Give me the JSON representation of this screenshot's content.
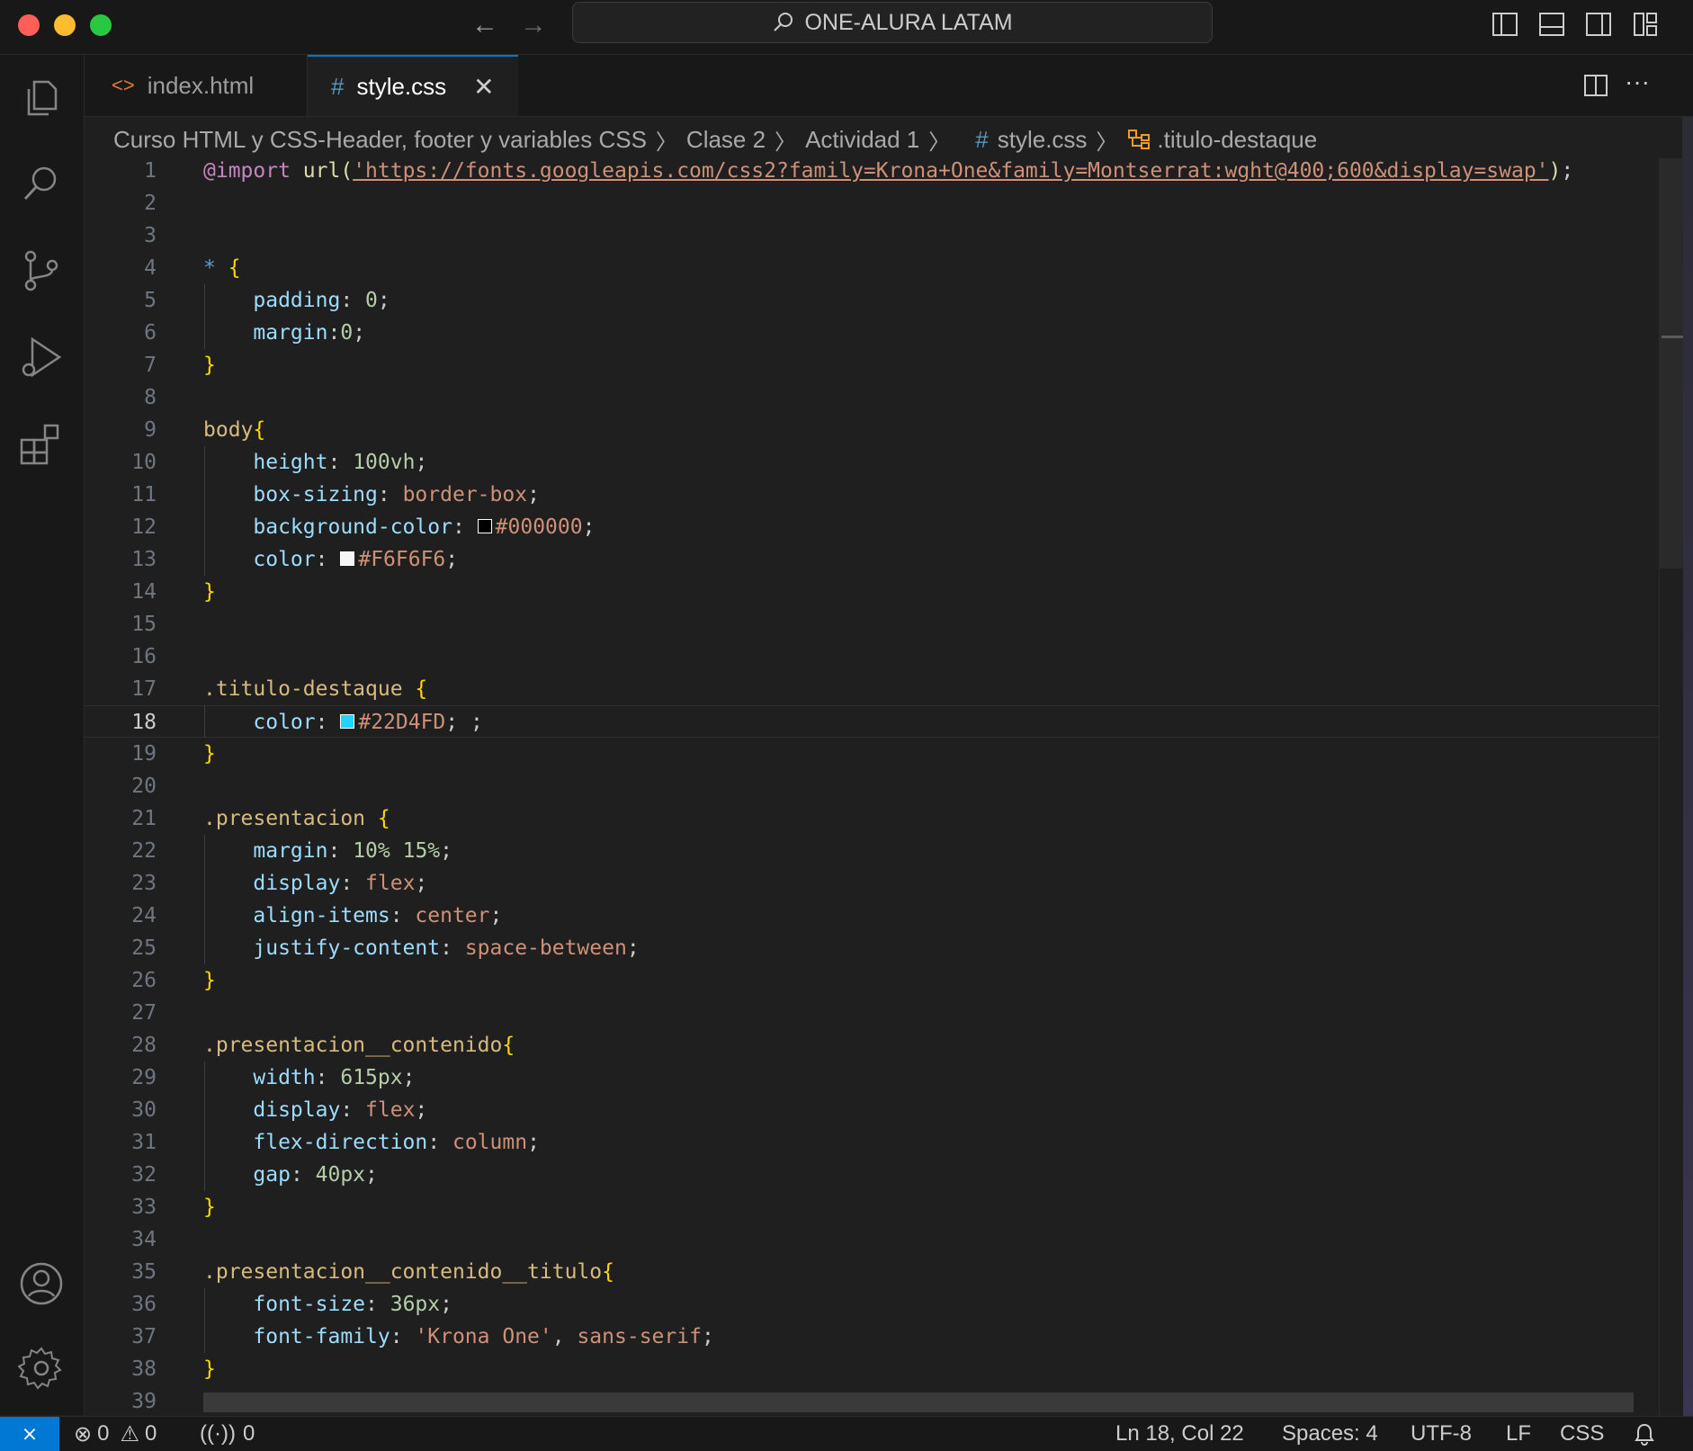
{
  "window": {
    "search_title": "ONE-ALURA LATAM",
    "traffic_lights": [
      "#ff5f57",
      "#febc2e",
      "#28c840"
    ]
  },
  "tabs": [
    {
      "label": "index.html",
      "icon": "html-file-icon",
      "active": false
    },
    {
      "label": "style.css",
      "icon": "css-file-icon",
      "active": true
    }
  ],
  "breadcrumb": {
    "items": [
      "Curso HTML y CSS-Header, footer y variables CSS",
      "Clase 2",
      "Actividad 1",
      "style.css",
      ".titulo-destaque"
    ]
  },
  "editor": {
    "language": "CSS",
    "current_line": 18,
    "lines": [
      {
        "n": "1",
        "tokens": [
          [
            "at",
            "@import"
          ],
          [
            "plain",
            " "
          ],
          [
            "fn",
            "url("
          ],
          [
            "str-u",
            "'https://fonts.googleapis.com/css2?family=Krona+One&family=Montserrat:wght@400;600&display=swap'"
          ],
          [
            "fn",
            ")"
          ],
          [
            "plain",
            ";"
          ]
        ]
      },
      {
        "n": "2",
        "tokens": []
      },
      {
        "n": "3",
        "tokens": []
      },
      {
        "n": "4",
        "tokens": [
          [
            "star",
            "*"
          ],
          [
            "plain",
            " "
          ],
          [
            "brace",
            "{"
          ]
        ]
      },
      {
        "n": "5",
        "tokens": [
          [
            "plain",
            "    "
          ],
          [
            "prop",
            "padding"
          ],
          [
            "plain",
            ": "
          ],
          [
            "num",
            "0"
          ],
          [
            "plain",
            ";"
          ]
        ]
      },
      {
        "n": "6",
        "tokens": [
          [
            "plain",
            "    "
          ],
          [
            "prop",
            "margin"
          ],
          [
            "plain",
            ":"
          ],
          [
            "num",
            "0"
          ],
          [
            "plain",
            ";"
          ]
        ]
      },
      {
        "n": "7",
        "tokens": [
          [
            "brace",
            "}"
          ]
        ]
      },
      {
        "n": "8",
        "tokens": []
      },
      {
        "n": "9",
        "tokens": [
          [
            "sel",
            "body"
          ],
          [
            "brace",
            "{"
          ]
        ]
      },
      {
        "n": "10",
        "tokens": [
          [
            "plain",
            "    "
          ],
          [
            "prop",
            "height"
          ],
          [
            "plain",
            ": "
          ],
          [
            "num",
            "100vh"
          ],
          [
            "plain",
            ";"
          ]
        ]
      },
      {
        "n": "11",
        "tokens": [
          [
            "plain",
            "    "
          ],
          [
            "prop",
            "box-sizing"
          ],
          [
            "plain",
            ": "
          ],
          [
            "val",
            "border-box"
          ],
          [
            "plain",
            ";"
          ]
        ]
      },
      {
        "n": "12",
        "tokens": [
          [
            "plain",
            "    "
          ],
          [
            "prop",
            "background-color"
          ],
          [
            "plain",
            ": "
          ],
          [
            "swatch",
            "#000000"
          ],
          [
            "val",
            "#000000"
          ],
          [
            "plain",
            ";"
          ]
        ]
      },
      {
        "n": "13",
        "tokens": [
          [
            "plain",
            "    "
          ],
          [
            "prop",
            "color"
          ],
          [
            "plain",
            ": "
          ],
          [
            "swatch",
            "#F6F6F6"
          ],
          [
            "val",
            "#F6F6F6"
          ],
          [
            "plain",
            ";"
          ]
        ]
      },
      {
        "n": "14",
        "tokens": [
          [
            "brace",
            "}"
          ]
        ]
      },
      {
        "n": "15",
        "tokens": []
      },
      {
        "n": "16",
        "tokens": []
      },
      {
        "n": "17",
        "tokens": [
          [
            "sel",
            ".titulo-destaque"
          ],
          [
            "plain",
            " "
          ],
          [
            "brace",
            "{"
          ]
        ]
      },
      {
        "n": "18",
        "tokens": [
          [
            "plain",
            "    "
          ],
          [
            "prop",
            "color"
          ],
          [
            "plain",
            ": "
          ],
          [
            "swatch",
            "#22D4FD"
          ],
          [
            "val",
            "#22D4FD"
          ],
          [
            "plain",
            "; ;"
          ]
        ]
      },
      {
        "n": "19",
        "tokens": [
          [
            "brace",
            "}"
          ]
        ]
      },
      {
        "n": "20",
        "tokens": []
      },
      {
        "n": "21",
        "tokens": [
          [
            "sel",
            ".presentacion"
          ],
          [
            "plain",
            " "
          ],
          [
            "brace",
            "{"
          ]
        ]
      },
      {
        "n": "22",
        "tokens": [
          [
            "plain",
            "    "
          ],
          [
            "prop",
            "margin"
          ],
          [
            "plain",
            ": "
          ],
          [
            "num",
            "10%"
          ],
          [
            "plain",
            " "
          ],
          [
            "num",
            "15%"
          ],
          [
            "plain",
            ";"
          ]
        ]
      },
      {
        "n": "23",
        "tokens": [
          [
            "plain",
            "    "
          ],
          [
            "prop",
            "display"
          ],
          [
            "plain",
            ": "
          ],
          [
            "val",
            "flex"
          ],
          [
            "plain",
            ";"
          ]
        ]
      },
      {
        "n": "24",
        "tokens": [
          [
            "plain",
            "    "
          ],
          [
            "prop",
            "align-items"
          ],
          [
            "plain",
            ": "
          ],
          [
            "val",
            "center"
          ],
          [
            "plain",
            ";"
          ]
        ]
      },
      {
        "n": "25",
        "tokens": [
          [
            "plain",
            "    "
          ],
          [
            "prop",
            "justify-content"
          ],
          [
            "plain",
            ": "
          ],
          [
            "val",
            "space-between"
          ],
          [
            "plain",
            ";"
          ]
        ]
      },
      {
        "n": "26",
        "tokens": [
          [
            "brace",
            "}"
          ]
        ]
      },
      {
        "n": "27",
        "tokens": []
      },
      {
        "n": "28",
        "tokens": [
          [
            "sel",
            ".presentacion__contenido"
          ],
          [
            "brace",
            "{"
          ]
        ]
      },
      {
        "n": "29",
        "tokens": [
          [
            "plain",
            "    "
          ],
          [
            "prop",
            "width"
          ],
          [
            "plain",
            ": "
          ],
          [
            "num",
            "615px"
          ],
          [
            "plain",
            ";"
          ]
        ]
      },
      {
        "n": "30",
        "tokens": [
          [
            "plain",
            "    "
          ],
          [
            "prop",
            "display"
          ],
          [
            "plain",
            ": "
          ],
          [
            "val",
            "flex"
          ],
          [
            "plain",
            ";"
          ]
        ]
      },
      {
        "n": "31",
        "tokens": [
          [
            "plain",
            "    "
          ],
          [
            "prop",
            "flex-direction"
          ],
          [
            "plain",
            ": "
          ],
          [
            "val",
            "column"
          ],
          [
            "plain",
            ";"
          ]
        ]
      },
      {
        "n": "32",
        "tokens": [
          [
            "plain",
            "    "
          ],
          [
            "prop",
            "gap"
          ],
          [
            "plain",
            ": "
          ],
          [
            "num",
            "40px"
          ],
          [
            "plain",
            ";"
          ]
        ]
      },
      {
        "n": "33",
        "tokens": [
          [
            "brace",
            "}"
          ]
        ]
      },
      {
        "n": "34",
        "tokens": []
      },
      {
        "n": "35",
        "tokens": [
          [
            "sel",
            ".presentacion__contenido__titulo"
          ],
          [
            "brace",
            "{"
          ]
        ]
      },
      {
        "n": "36",
        "tokens": [
          [
            "plain",
            "    "
          ],
          [
            "prop",
            "font-size"
          ],
          [
            "plain",
            ": "
          ],
          [
            "num",
            "36px"
          ],
          [
            "plain",
            ";"
          ]
        ]
      },
      {
        "n": "37",
        "tokens": [
          [
            "plain",
            "    "
          ],
          [
            "prop",
            "font-family"
          ],
          [
            "plain",
            ": "
          ],
          [
            "val",
            "'Krona One'"
          ],
          [
            "plain",
            ", "
          ],
          [
            "val",
            "sans-serif"
          ],
          [
            "plain",
            ";"
          ]
        ]
      },
      {
        "n": "38",
        "tokens": [
          [
            "brace",
            "}"
          ]
        ]
      },
      {
        "n": "39",
        "tokens": []
      }
    ]
  },
  "statusbar": {
    "errors": "0",
    "warnings": "0",
    "ports": "0",
    "position": "Ln 18, Col 22",
    "spaces": "Spaces: 4",
    "encoding": "UTF-8",
    "eol": "LF",
    "language": "CSS"
  },
  "colors": {
    "accent": "#0078d4",
    "editor_bg": "#1f1f1f",
    "chrome_bg": "#181818"
  }
}
